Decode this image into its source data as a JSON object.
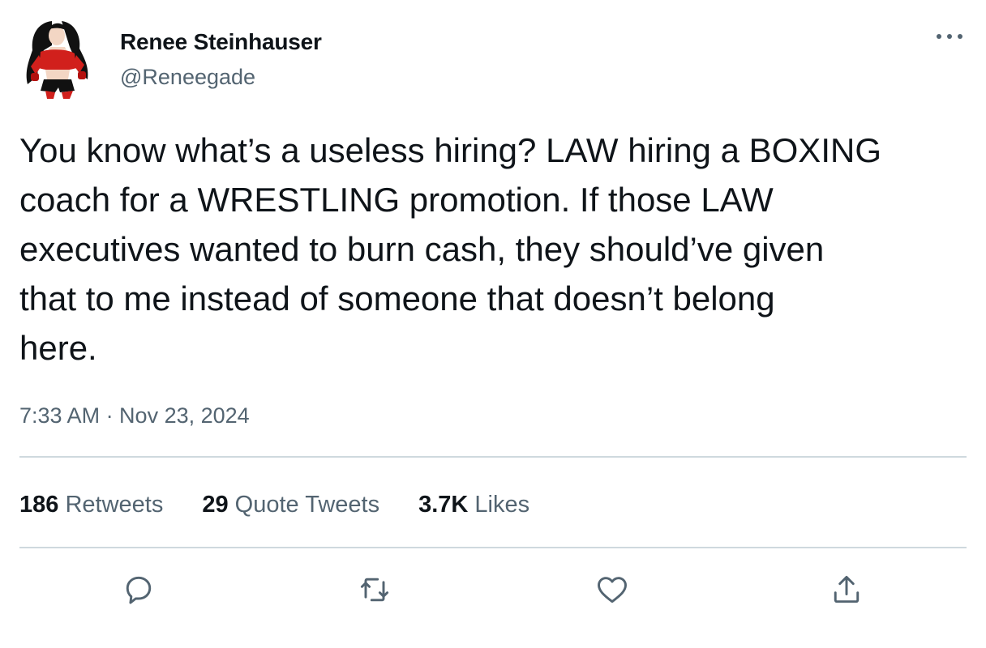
{
  "author": {
    "display_name": "Renee Steinhauser",
    "handle": "@Reneegade"
  },
  "tweet": {
    "text": "You know what’s a useless hiring? LAW hiring a BOXING\ncoach for a WRESTLING promotion. If those LAW\nexecutives wanted to burn cash, they should’ve given\nthat to me instead of someone that doesn’t belong\nhere.",
    "timestamp": "7:33 AM · Nov 23, 2024"
  },
  "stats": [
    {
      "count": "186",
      "label": "Retweets"
    },
    {
      "count": "29",
      "label": "Quote Tweets"
    },
    {
      "count": "3.7K",
      "label": "Likes"
    }
  ],
  "actions": [
    "reply-icon",
    "retweet-icon",
    "like-icon",
    "share-icon"
  ],
  "colors": {
    "primary_text": "#0f1419",
    "secondary_text": "#536471",
    "divider": "#cfd9de"
  }
}
